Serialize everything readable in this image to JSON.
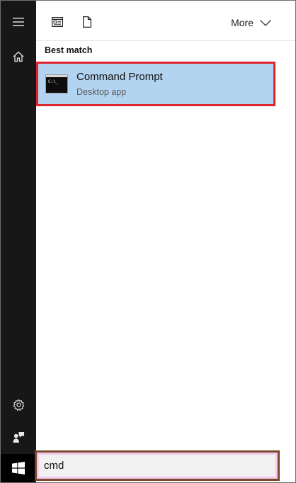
{
  "toolbar": {
    "apps_filter_icon": "apps-filter-icon",
    "documents_filter_icon": "document-icon",
    "more_label": "More"
  },
  "results": {
    "section_heading": "Best match",
    "best_match": {
      "title": "Command Prompt",
      "subtitle": "Desktop app",
      "icon_text": "C:\\_",
      "icon": "command-prompt-icon"
    }
  },
  "search": {
    "query": "cmd"
  },
  "rail": {
    "items": [
      {
        "icon": "hamburger-menu-icon"
      },
      {
        "icon": "home-icon"
      },
      {
        "icon": "gear-icon"
      },
      {
        "icon": "feedback-icon"
      },
      {
        "icon": "windows-start-icon"
      }
    ]
  },
  "colors": {
    "rail_background": "#171717",
    "selected_result": "#b2d4f0",
    "result_highlight_border": "#e0242e",
    "search_box_border": "#7a4a2a"
  }
}
